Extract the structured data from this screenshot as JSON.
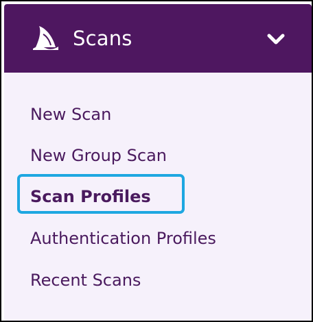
{
  "header": {
    "title": "Scans",
    "logo_icon": "shark-fin-icon",
    "toggle_icon": "chevron-down-icon"
  },
  "menu": {
    "items": [
      {
        "label": "New Scan",
        "active": false
      },
      {
        "label": "New Group Scan",
        "active": false
      },
      {
        "label": "Scan Profiles",
        "active": true
      },
      {
        "label": "Authentication Profiles",
        "active": false
      },
      {
        "label": "Recent Scans",
        "active": false
      }
    ]
  },
  "colors": {
    "header_bg": "#4e1760",
    "panel_bg": "#f6f1fb",
    "text": "#4a1a5e",
    "highlight": "#1ea7e1"
  }
}
